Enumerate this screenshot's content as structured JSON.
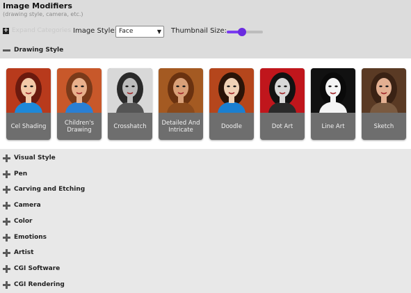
{
  "header": {
    "title": "Image Modifiers",
    "subtitle": "(drawing style, camera, etc.)"
  },
  "toolbar": {
    "expand_label": "Expand Categories",
    "image_style_label": "Image Style:",
    "image_style_value": "Face",
    "thumbnail_size_label": "Thumbnail Size:",
    "thumbnail_size_level": 0.42
  },
  "drawing_style": {
    "label": "Drawing Style",
    "modifiers": [
      {
        "label": "Cel Shading",
        "bg": "#b83a1c",
        "skin": "#f2c9a8",
        "hair": "#6b1a0e",
        "shirt": "#1e88d8"
      },
      {
        "label": "Children's Drawing",
        "bg": "#c8582a",
        "skin": "#e9b08c",
        "hair": "#7a3a1a",
        "shirt": "#2a7fd4"
      },
      {
        "label": "Crosshatch",
        "bg": "#d8d8d8",
        "skin": "#bdbdbd",
        "hair": "#2a2a2a",
        "shirt": "#555555"
      },
      {
        "label": "Detailed And Intricate",
        "bg": "#a45a22",
        "skin": "#d9a078",
        "hair": "#6a3210",
        "shirt": "#8a4a1c"
      },
      {
        "label": "Doodle",
        "bg": "#b5461c",
        "skin": "#f0d2b6",
        "hair": "#2a1408",
        "shirt": "#1b7fd0"
      },
      {
        "label": "Dot Art",
        "bg": "#c0161c",
        "skin": "#d8d8d8",
        "hair": "#121212",
        "shirt": "#2a2a2a"
      },
      {
        "label": "Line Art",
        "bg": "#111111",
        "skin": "#f4f4f4",
        "hair": "#0a0a0a",
        "shirt": "#f4f4f4"
      },
      {
        "label": "Sketch",
        "bg": "#5a3a24",
        "skin": "#e3b092",
        "hair": "#3a2214",
        "shirt": "#7a5a40"
      }
    ]
  },
  "categories": [
    {
      "label": "Visual Style"
    },
    {
      "label": "Pen"
    },
    {
      "label": "Carving and Etching"
    },
    {
      "label": "Camera"
    },
    {
      "label": "Color"
    },
    {
      "label": "Emotions"
    },
    {
      "label": "Artist"
    },
    {
      "label": "CGI Software"
    },
    {
      "label": "CGI Rendering"
    }
  ],
  "colors": {
    "accent": "#6a2be0",
    "card": "#6e6e6e",
    "panel": "#ffffff",
    "page": "#e8e8e8"
  }
}
